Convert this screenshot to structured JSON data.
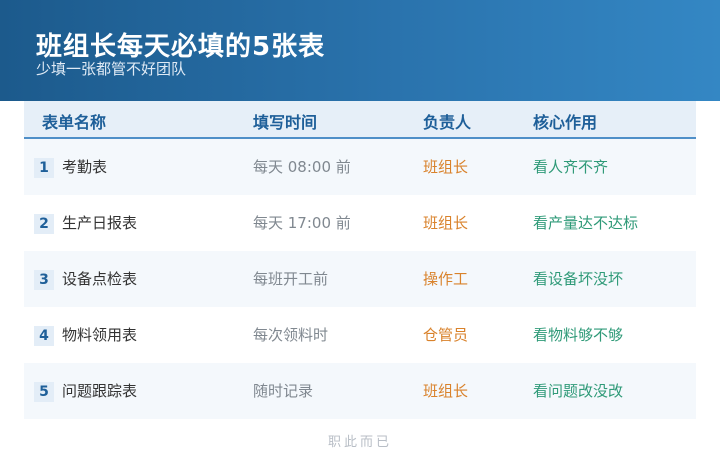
{
  "header": {
    "title": "班组长每天必填的5张表",
    "subtitle": "少填一张都管不好团队"
  },
  "table": {
    "columns": [
      "表单名称",
      "填写时间",
      "负责人",
      "核心作用"
    ],
    "rows": [
      {
        "num": "1",
        "name": "考勤表",
        "time": "每天 08:00 前",
        "owner": "班组长",
        "purpose": "看人齐不齐"
      },
      {
        "num": "2",
        "name": "生产日报表",
        "time": "每天 17:00 前",
        "owner": "班组长",
        "purpose": "看产量达不达标"
      },
      {
        "num": "3",
        "name": "设备点检表",
        "time": "每班开工前",
        "owner": "操作工",
        "purpose": "看设备坏没坏"
      },
      {
        "num": "4",
        "name": "物料领用表",
        "time": "每次领料时",
        "owner": "仓管员",
        "purpose": "看物料够不够"
      },
      {
        "num": "5",
        "name": "问题跟踪表",
        "time": "随时记录",
        "owner": "班组长",
        "purpose": "看问题改没改"
      }
    ]
  },
  "footer": {
    "text": "职此而已"
  },
  "colors": {
    "banner": "#2a73ad",
    "header_text": "#1e5f99",
    "owner": "#d9822b",
    "purpose": "#2f9a78"
  }
}
